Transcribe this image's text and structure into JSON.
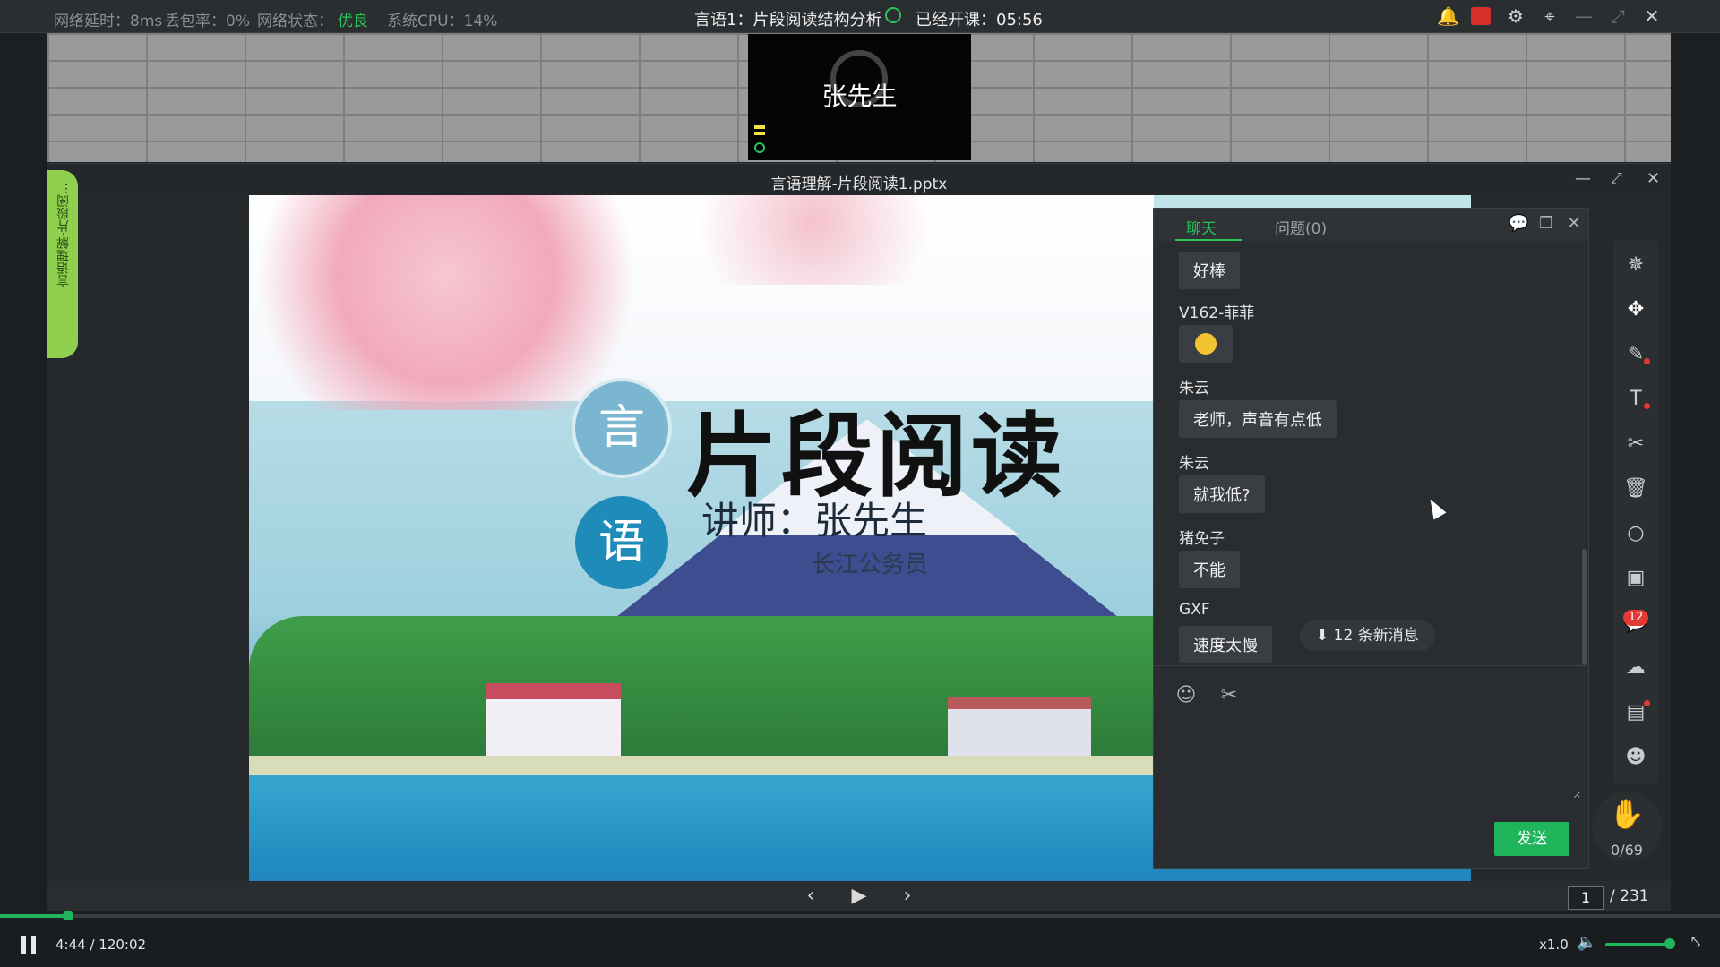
{
  "status_bar": {
    "latency": "网络延时：8ms",
    "loss": "丢包率：0%",
    "net_label": "网络状态：",
    "net_value": "优良",
    "cpu": "系统CPU：14%",
    "course": "言语1：片段阅读结构分析",
    "elapsed": "已经开课：05:56",
    "icons": [
      "bell-icon",
      "record-icon",
      "gear-icon",
      "pin-icon",
      "minimize-icon",
      "maximize-icon",
      "close-icon"
    ]
  },
  "teacher_video": {
    "name": "张先生"
  },
  "document": {
    "title": "言语理解-片段阅读1.pptx"
  },
  "side_tab": {
    "label": "言语理解-片段阅..."
  },
  "slide": {
    "circle_1": "言",
    "circle_2": "语",
    "title": "片段阅读",
    "lecturer": "讲师：张先生",
    "org": "长江公务员"
  },
  "chat": {
    "tabs": {
      "chat": "聊天",
      "questions": "问题(0)"
    },
    "messages": [
      {
        "name": "",
        "text": "好棒"
      },
      {
        "name": "V162-菲菲",
        "text": ""
      },
      {
        "name": "朱云",
        "text": "老师，声音有点低"
      },
      {
        "name": "朱云",
        "text": "就我低?"
      },
      {
        "name": "猪免子",
        "text": "不能"
      },
      {
        "name": "GXF",
        "text": "速度太慢"
      }
    ],
    "new_messages": "12 条新消息",
    "input_value": "",
    "send": "发送"
  },
  "toolbar": {
    "icons": [
      "laser-pointer-icon",
      "select-move-icon",
      "pen-icon",
      "text-icon",
      "scissors-icon",
      "trash-icon",
      "eraser-icon",
      "whiteboard-icon",
      "chat-icon",
      "cloud-icon",
      "toolbox-icon",
      "users-icon"
    ],
    "chat_badge": "12",
    "hand_count": "0/69"
  },
  "pager": {
    "current": "1",
    "total": "/ 231"
  },
  "player": {
    "current": "4:44",
    "duration": "/ 120:02",
    "speed": "x1.0",
    "progress": 0.0394,
    "volume": 0.9
  },
  "colors": {
    "accent": "#1fb55b",
    "status_good": "#29c45a",
    "badge": "#e53935"
  }
}
